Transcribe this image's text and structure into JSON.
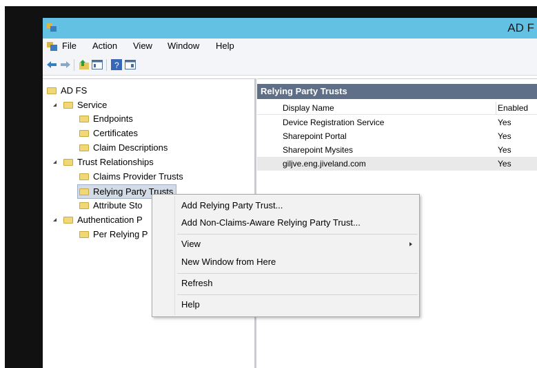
{
  "window": {
    "title": "AD F"
  },
  "menubar": {
    "items": [
      "File",
      "Action",
      "View",
      "Window",
      "Help"
    ]
  },
  "toolbar": {
    "icons": [
      "back-arrow-icon",
      "forward-arrow-icon",
      "up-folder-icon",
      "show-hide-console-tree-icon",
      "help-icon",
      "show-hide-action-pane-icon"
    ]
  },
  "tree": {
    "root": "AD FS",
    "service": "Service",
    "endpoints": "Endpoints",
    "certificates": "Certificates",
    "claim_descriptions": "Claim Descriptions",
    "trust_relationships": "Trust Relationships",
    "claims_provider_trusts": "Claims Provider Trusts",
    "relying_party_trusts": "Relying Party Trusts",
    "attribute_stores": "Attribute Sto",
    "authentication_policies": "Authentication P",
    "per_relying_party": "Per Relying P"
  },
  "right_pane": {
    "header": "Relying Party Trusts",
    "columns": [
      "Display Name",
      "Enabled"
    ],
    "rows": [
      {
        "name": "Device Registration Service",
        "enabled": "Yes"
      },
      {
        "name": "Sharepoint Portal",
        "enabled": "Yes"
      },
      {
        "name": "Sharepoint Mysites",
        "enabled": "Yes"
      },
      {
        "name": "giljve.eng.jiveland.com",
        "enabled": "Yes"
      }
    ]
  },
  "context_menu": {
    "add_rp": "Add Relying Party Trust...",
    "add_non_claims": "Add Non-Claims-Aware Relying Party Trust...",
    "view": "View",
    "new_window": "New Window from Here",
    "refresh": "Refresh",
    "help": "Help"
  },
  "colors": {
    "titlebar": "#63c2e3",
    "pane_header": "#5e6f87",
    "folder": "#f0d879"
  }
}
